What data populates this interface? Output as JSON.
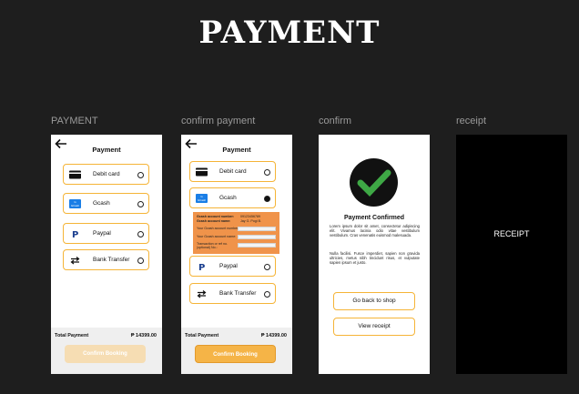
{
  "page": {
    "title": "PAYMENT"
  },
  "frames": {
    "payment": {
      "label": "PAYMENT",
      "header": "Payment",
      "options": [
        {
          "label": "Debit card",
          "icon": "card-icon",
          "selected": false
        },
        {
          "label": "Gcash",
          "icon": "gcash-icon",
          "selected": false
        },
        {
          "label": "Paypal",
          "icon": "paypal-icon",
          "selected": false
        },
        {
          "label": "Bank Transfer",
          "icon": "transfer-icon",
          "selected": false
        }
      ],
      "total_label": "Total Payment",
      "total_value": "₱ 14399.00",
      "confirm_label": "Confirm Booking",
      "confirm_color": "#f6ddb3"
    },
    "confirm_payment": {
      "label": "confirm payment",
      "header": "Payment",
      "options": [
        {
          "label": "Debit card",
          "icon": "card-icon",
          "selected": false
        },
        {
          "label": "Gcash",
          "icon": "gcash-icon",
          "selected": true
        },
        {
          "label": "Paypal",
          "icon": "paypal-icon",
          "selected": false
        },
        {
          "label": "Bank Transfer",
          "icon": "transfer-icon",
          "selected": false
        }
      ],
      "gcash_details": {
        "account_number_label": "Gcash account number:",
        "account_number_value": "09123456789",
        "account_name_label": "Gcash account name:",
        "account_name_value": "Jay G. Pogi B.",
        "fields": [
          "Your Gcash account number:",
          "Your Gcash account name:",
          "Transaction or ref no.(optional) No.:"
        ]
      },
      "total_label": "Total Payment",
      "total_value": "₱ 14399.00",
      "confirm_label": "Confirm Booking",
      "confirm_color": "#f5b447"
    },
    "confirm": {
      "label": "confirm",
      "title": "Payment Confirmed",
      "paragraph1": "Lorem ipsum dolor sit amet, consectetur adipiscing elit. Vivamus lacinia odio vitae vestibulum vestibulum. Cras venenatis euismod malesuada.",
      "paragraph2": "Nulla facilisi. Fusce imperdiet, sapien non gravida ultricies, metus nibh tincidunt risus, et vulputate sapien ipsum et justo.",
      "back_label": "Go back to shop",
      "view_label": "View  receipt",
      "check_color": "#3ea845"
    },
    "receipt": {
      "label": "receipt",
      "text": "RECEIPT"
    }
  },
  "colors": {
    "accent": "#f5b437",
    "background": "#1e1e1e"
  }
}
